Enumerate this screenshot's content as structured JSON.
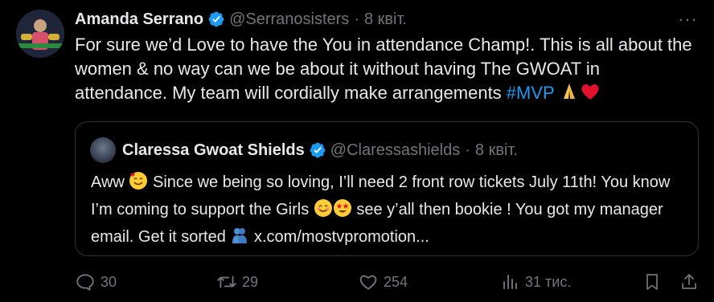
{
  "author": {
    "name": "Amanda Serrano",
    "handle": "@Serranosisters",
    "separator": "·",
    "date": "8 квіт."
  },
  "more_label": "···",
  "tweet": {
    "text_main": "For sure we’d Love to have the You in attendance Champ!. This is all about the women & no way can we be about it without having  The GWOAT in attendance. My team will cordially make arrangements ",
    "hashtag": "#MVP",
    "emoji_pray": "🙏",
    "emoji_heart": "❤"
  },
  "quote": {
    "name": "Claressa Gwoat Shields",
    "handle": "@Claressashields",
    "separator": "·",
    "date": "8 квіт.",
    "text_1": "Aww ",
    "emoji_hearts": "🥰",
    "text_2": " Since we being so loving,  I’ll need 2 front row tickets July 11th! You know I’m coming to support the Girls ",
    "emoji_blush": "😊",
    "emoji_star": "🤩",
    "text_3": " see y’all then bookie ! You got my manager email. Get it sorted ",
    "emoji_people": "🫂",
    "link": " x.com/mostvpromotion..."
  },
  "actions": {
    "replies": "30",
    "reposts": "29",
    "likes": "254",
    "views": "31 тис."
  },
  "colors": {
    "background": "#000000",
    "text": "#e7e9ea",
    "secondary": "#71767b",
    "accent": "#1d9bf0",
    "border": "#2f3336"
  },
  "icons": [
    "verified-badge-icon",
    "more-icon",
    "reply-icon",
    "repost-icon",
    "like-icon",
    "views-icon",
    "bookmark-icon",
    "share-icon"
  ]
}
